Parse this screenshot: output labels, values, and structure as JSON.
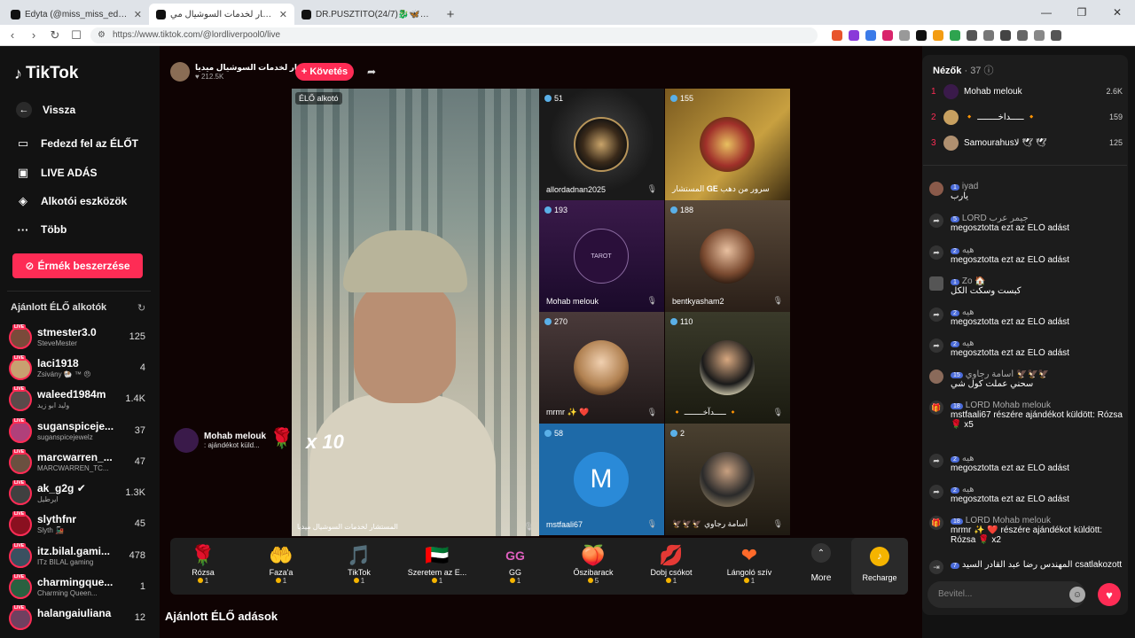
{
  "browser": {
    "tabs": [
      {
        "label": "Edyta (@miss_miss_edyta) ÉLŐ a"
      },
      {
        "label": "المستشار لخدمات السوشيال مي"
      },
      {
        "label": "DR.PUSZTÍTÓ(24/7)🐉🦋💚🥀"
      }
    ],
    "url": "https://www.tiktok.com/@lordliverpool0/live"
  },
  "sidebar": {
    "logo": "TikTok",
    "back": "Vissza",
    "nav": [
      {
        "label": "Fedezd fel az ÉLŐT",
        "icon": "live-tv-icon"
      },
      {
        "label": "LIVE ADÁS",
        "icon": "camera-icon"
      },
      {
        "label": "Alkotói eszközök",
        "icon": "lightbulb-icon"
      },
      {
        "label": "Több",
        "icon": "more-dots-icon"
      }
    ],
    "coins_button": "Érmék beszerzése",
    "section_title": "Ajánlott ÉLŐ alkotók",
    "creators": [
      {
        "name": "stmester3.0",
        "sub": "SteveMester",
        "count": "125"
      },
      {
        "name": "laci1918",
        "sub": "Zsivány 🐏 ™ 😠",
        "count": "4"
      },
      {
        "name": "waleed1984m",
        "sub": "وليد ابو زيد",
        "count": "1.4K"
      },
      {
        "name": "suganspiceje...",
        "sub": "suganspicejewelz",
        "count": "37"
      },
      {
        "name": "marcwarren_...",
        "sub": "MARCWARREN_TC...",
        "count": "47"
      },
      {
        "name": "ak_g2g ✔",
        "sub": "ايرطيل",
        "count": "1.3K"
      },
      {
        "name": "slythfnr",
        "sub": "Slyth 🚂",
        "count": "45"
      },
      {
        "name": "itz.bilal.gami...",
        "sub": "ITz BILAL gaming",
        "count": "478"
      },
      {
        "name": "charmingque...",
        "sub": "Charming Queen...",
        "count": "1"
      },
      {
        "name": "halangaiuliana",
        "sub": "",
        "count": "12"
      }
    ]
  },
  "stream": {
    "host_name": "شار لخدمات السوشيال ميديا...",
    "host_likes": "♥ 212.5K",
    "follow_button": "+ Követés",
    "live_badge": "ÉLŐ alkotó",
    "main_name": "المستشار لخدمات السوشيال ميديا",
    "gift_notice": {
      "name": "Mohab melouk",
      "text": ": ajándékot küld...",
      "multiplier": "x 10"
    },
    "tiles": [
      {
        "viewers": "51",
        "name": "allordadnan2025"
      },
      {
        "viewers": "155",
        "name": "المستشار 𝐆𝐄 سرور من دهب"
      },
      {
        "viewers": "193",
        "name": "Mohab melouk"
      },
      {
        "viewers": "188",
        "name": "bentkyasham2"
      },
      {
        "viewers": "270",
        "name": "mrmr ✨ ❤️"
      },
      {
        "viewers": "110",
        "name": "🔸 ـــــدآخــــــــ 🔸"
      },
      {
        "viewers": "58",
        "name": "mstfaali67"
      },
      {
        "viewers": "2",
        "name": "🦅🦅🦅 أسامة رجاوي"
      }
    ],
    "tile_initial": "M",
    "tarot_label": "TAROT"
  },
  "gifts": [
    {
      "label": "Rózsa",
      "price": "1",
      "icon": "🌹"
    },
    {
      "label": "Faza'a",
      "price": "1",
      "icon": "🤲"
    },
    {
      "label": "TikTok",
      "price": "1",
      "icon": "🎵"
    },
    {
      "label": "Szeretem az E...",
      "price": "1",
      "icon": "🇦🇪"
    },
    {
      "label": "GG",
      "price": "1",
      "icon": "GG"
    },
    {
      "label": "Őszibarack",
      "price": "5",
      "icon": "🍑"
    },
    {
      "label": "Dobj csókot",
      "price": "1",
      "icon": "💋"
    },
    {
      "label": "Lángoló szív",
      "price": "1",
      "icon": "❤"
    }
  ],
  "more_label": "More",
  "recharge_label": "Recharge",
  "bottom_title": "Ajánlott ÉLŐ adások",
  "chat": {
    "viewers_label": "Nézők",
    "viewers_count": "· 37",
    "top": [
      {
        "rank": "1",
        "name": "Mohab melouk",
        "value": "2.6K"
      },
      {
        "rank": "2",
        "name": "🔸 ـــــدآخــــــــ 🔸",
        "value": "159"
      },
      {
        "rank": "3",
        "name": "Samourahusلا 🕊 🕊",
        "value": "125"
      }
    ],
    "messages": [
      {
        "level": "1",
        "user": "iyad",
        "text": "يارب"
      },
      {
        "level": "5",
        "user": "LORD جيمر عرب",
        "text": "megosztotta ezt az ÉLŐ adást"
      },
      {
        "level": "2",
        "user": "هيه",
        "text": "megosztotta ezt az ÉLŐ adást"
      },
      {
        "level": "1",
        "user": "Zo 🏠",
        "text": "كبست وسكت الكل"
      },
      {
        "level": "2",
        "user": "هيه",
        "text": "megosztotta ezt az ÉLŐ adást"
      },
      {
        "level": "2",
        "user": "هيه",
        "text": "megosztotta ezt az ÉLŐ adást"
      },
      {
        "level": "15",
        "user": "أسامة رجاوي 🦅🦅🦅",
        "text": "سحني عملت كول شي"
      },
      {
        "level": "18",
        "user": "LORD Mohab melouk",
        "text": "mstfaali67 részére ajándékot küldött: Rózsa 🌹 x5"
      },
      {
        "level": "2",
        "user": "هيه",
        "text": "megosztotta ezt az ÉLŐ adást"
      },
      {
        "level": "2",
        "user": "هيه",
        "text": "megosztotta ezt az ÉLŐ adást"
      },
      {
        "level": "18",
        "user": "LORD Mohab melouk",
        "text": "mrmr ✨ ❤️ részére ajándékot küldött: Rózsa 🌹 x2"
      },
      {
        "level": "7",
        "user": "المهندس رضا عبد القادر السيد",
        "text": "csatlakozott"
      }
    ],
    "input_placeholder": "Bevitel..."
  }
}
